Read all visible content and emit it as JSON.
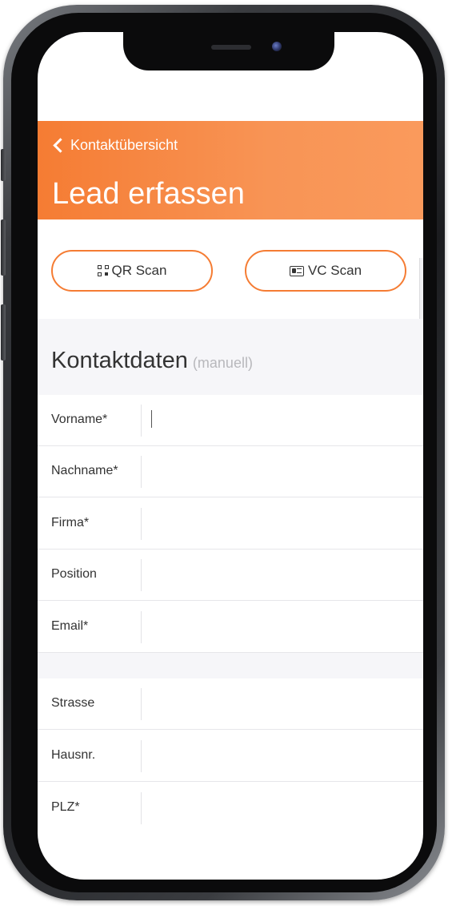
{
  "header": {
    "back_label": "Kontaktübersicht",
    "title": "Lead erfassen",
    "accent_color": "#f57c33"
  },
  "scan_buttons": {
    "qr_label": "QR Scan",
    "qr_icon": "qr-code-icon",
    "vc_label": "VC Scan",
    "vc_icon": "vcard-icon"
  },
  "section": {
    "title": "Kontaktdaten",
    "subtitle": "(manuell)"
  },
  "form": {
    "fields": [
      {
        "label": "Vorname*",
        "value": ""
      },
      {
        "label": "Nachname*",
        "value": ""
      },
      {
        "label": "Firma*",
        "value": ""
      },
      {
        "label": "Position",
        "value": ""
      },
      {
        "label": "Email*",
        "value": ""
      },
      {
        "label": "Strasse",
        "value": ""
      },
      {
        "label": "Hausnr.",
        "value": ""
      },
      {
        "label": "PLZ*",
        "value": ""
      }
    ]
  }
}
